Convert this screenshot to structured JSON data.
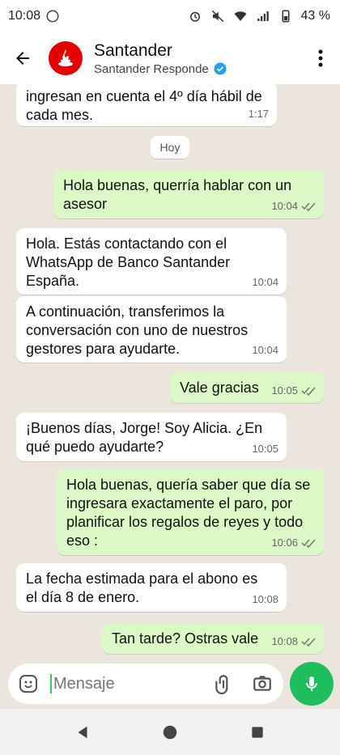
{
  "status_bar": {
    "time": "10:08",
    "battery": "43 %",
    "icons": [
      "whatsapp-icon",
      "alarm-icon",
      "mute-icon",
      "wifi-icon",
      "signal-icon",
      "battery-icon"
    ]
  },
  "header": {
    "title": "Santander",
    "subtitle": "Santander Responde",
    "verified": true,
    "brand_color": "#E60000"
  },
  "chat": {
    "date_chip": "Hoy",
    "messages": [
      {
        "direction": "in",
        "text": "ingresan en cuenta el 4º día hábil de\ncada mes.",
        "time": "1:17",
        "ticks": false
      },
      {
        "direction": "out",
        "text": "Hola buenas, querría hablar con un\nasesor",
        "time": "10:04",
        "ticks": true
      },
      {
        "direction": "in",
        "text": "Hola. Estás contactando con el\nWhatsApp de Banco Santander\nEspaña.",
        "time": "10:04",
        "ticks": false
      },
      {
        "direction": "in",
        "text": "A continuación, transferimos la\nconversación con uno de nuestros\ngestores para ayudarte.",
        "time": "10:04",
        "ticks": false
      },
      {
        "direction": "out",
        "text": "Vale gracias",
        "time": "10:05",
        "ticks": true
      },
      {
        "direction": "in",
        "text": "¡Buenos días, Jorge! Soy Alicia. ¿En\nqué puedo ayudarte?",
        "time": "10:05",
        "ticks": false
      },
      {
        "direction": "out",
        "text": "Hola buenas, quería saber que día se\ningresara exactamente el paro, por\nplanificar los regalos de reyes y todo\neso :",
        "time": "10:06",
        "ticks": true
      },
      {
        "direction": "in",
        "text": "La fecha estimada para el abono es\nel día 8 de enero.",
        "time": "10:08",
        "ticks": false
      },
      {
        "direction": "out",
        "text": "Tan tarde? Ostras vale",
        "time": "10:08",
        "ticks": true
      }
    ]
  },
  "input": {
    "placeholder": "Mensaje"
  },
  "colors": {
    "outgoing_bubble": "#DCF8C6",
    "incoming_bubble": "#FFFFFF",
    "accent_green": "#1EBE5D",
    "read_ticks": "#7a7a7a"
  }
}
